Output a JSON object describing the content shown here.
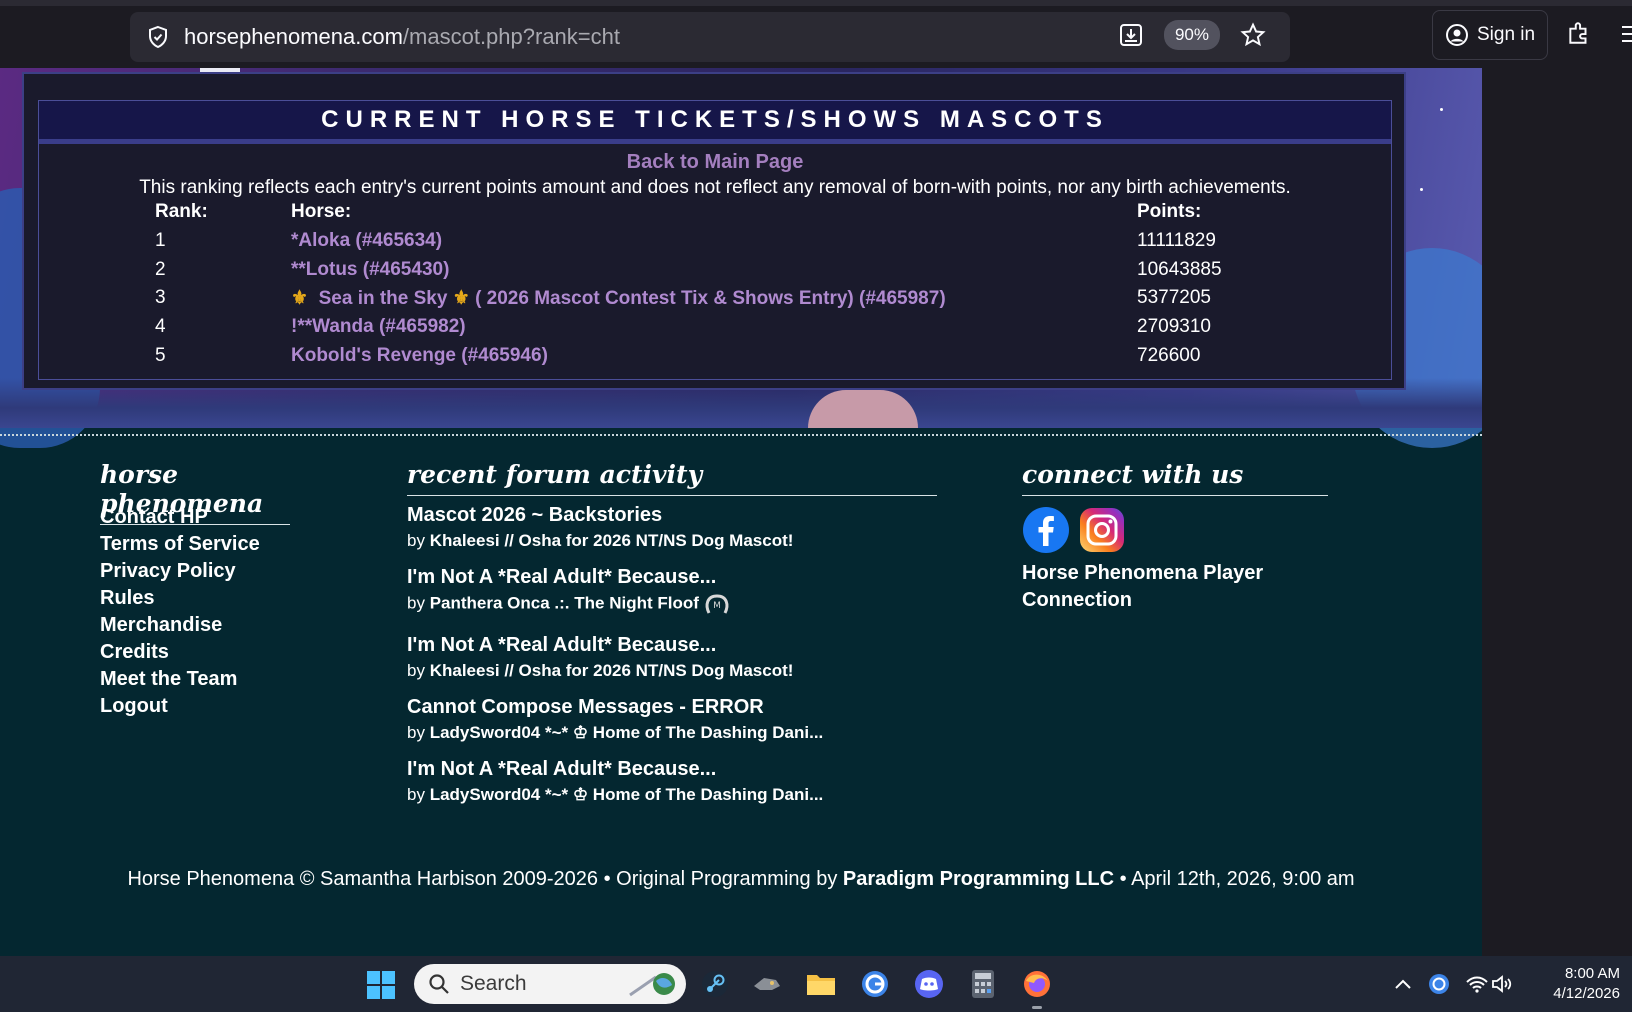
{
  "browser": {
    "url_domain": "horsephenomena.com",
    "url_path": "/mascot.php?rank=cht",
    "zoom": "90%",
    "sign_in": "Sign in"
  },
  "panel": {
    "title": "CURRENT HORSE TICKETS/SHOWS MASCOTS",
    "back_link": "Back to Main Page",
    "note": "This ranking reflects each entry's current points amount and does not reflect any removal of born-with points, nor any birth achievements.",
    "headers": {
      "rank": "Rank:",
      "horse": "Horse:",
      "points": "Points:"
    },
    "rows": [
      {
        "rank": "1",
        "horse": "*Aloka (#465634)",
        "points": "11111829"
      },
      {
        "rank": "2",
        "horse": "**Lotus (#465430)",
        "points": "10643885"
      },
      {
        "rank": "3",
        "horse_pre": "⚜",
        "horse": "Sea in the Sky",
        "horse_mid": "⚜",
        "horse_post": "( 2026 Mascot Contest Tix & Shows Entry) (#465987)",
        "points": "5377205"
      },
      {
        "rank": "4",
        "horse": "!**Wanda (#465982)",
        "points": "2709310"
      },
      {
        "rank": "5",
        "horse": "Kobold's Revenge (#465946)",
        "points": "726600"
      }
    ]
  },
  "footer": {
    "col1_title": "horse phenomena",
    "links": [
      "Contact HP",
      "Terms of Service",
      "Privacy Policy",
      "Rules",
      "Merchandise",
      "Credits",
      "Meet the Team",
      "Logout"
    ],
    "col2_title": "recent forum activity",
    "forum": [
      {
        "title": "Mascot 2026 ~ Backstories",
        "by": "by",
        "author": "Khaleesi // Osha for 2026 NT/NS Dog Mascot!"
      },
      {
        "title": "I'm Not A *Real Adult* Because...",
        "by": "by",
        "author": "Panthera Onca .:. The Night Floof"
      },
      {
        "title": "I'm Not A *Real Adult* Because...",
        "by": "by",
        "author": "Khaleesi // Osha for 2026 NT/NS Dog Mascot!"
      },
      {
        "title": "Cannot Compose Messages - ERROR",
        "by": "by",
        "author": "LadySword04 *~* ♔ Home of The Dashing Dani..."
      },
      {
        "title": "I'm Not A *Real Adult* Because...",
        "by": "by",
        "author": "LadySword04 *~* ♔ Home of The Dashing Dani..."
      }
    ],
    "col3_title": "connect with us",
    "connect_text": "Horse Phenomena Player Connection",
    "copyright_a": "Horse Phenomena © Samantha Harbison 2009-2026  •  Original Programming by",
    "copyright_b": "Paradigm Programming LLC",
    "copyright_c": "•  April 12th, 2026, 9:00 am"
  },
  "taskbar": {
    "search": "Search",
    "time": "8:00 AM",
    "date": "4/12/2026"
  },
  "colors": {
    "link": "#b08ad0",
    "footer_bg": "#042730",
    "panel_bg": "#1a1a2c"
  }
}
